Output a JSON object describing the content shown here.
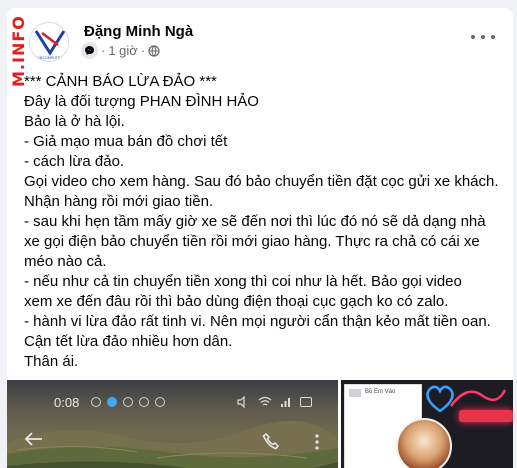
{
  "watermark": {
    "text": "M.INFO"
  },
  "post": {
    "author": "Đặng Minh Ngà",
    "time": "1 giờ",
    "avatar_logo_text": "VNCOMPUTER",
    "content": "*** CẢNH BÁO LỪA ĐẢO ***\nĐây là đối tượng PHAN ĐÌNH HẢO\nBảo là ở hà lội.\n- Giả mạo mua bán đồ chơi tết\n- cách lừa đảo.\nGọi video cho xem hàng. Sau đó bảo chuyển tiền đặt cọc gửi xe khách.\nNhận hàng rồi mới giao tiền.\n- sau khi hẹn tầm mấy giờ xe sẽ đến nơi thì lúc đó nó sẽ dả dạng nhà\nxe gọi điện bảo chuyển tiền rồi mới giao hàng. Thực ra chả có cái xe\nméo nào cả.\n- nếu như cả tin chuyển tiền xong thì coi như là hết. Bảo gọi video\nxem xe đến đâu rồi thì bảo dùng điện thoại cục gạch ko có zalo.\n- hành vi lừa đảo rất tinh vi. Nên mọi người cẩn thận kẻo mất tiền oan.\nCận tết lừa đảo nhiều hơn dân.\nThân ái."
  },
  "media": {
    "left": {
      "status_time": "0:08"
    },
    "right": {
      "shop_title": "Bồ Em Vào"
    }
  },
  "icons": {
    "more": "more-horizontal-icon",
    "audience": "globe-icon",
    "badge": "messenger-badge-icon"
  },
  "colors": {
    "card": "#ffffff",
    "page_bg": "#f0f2f5",
    "text": "#050505",
    "meta": "#65676b",
    "watermark": "#e41e1e"
  }
}
